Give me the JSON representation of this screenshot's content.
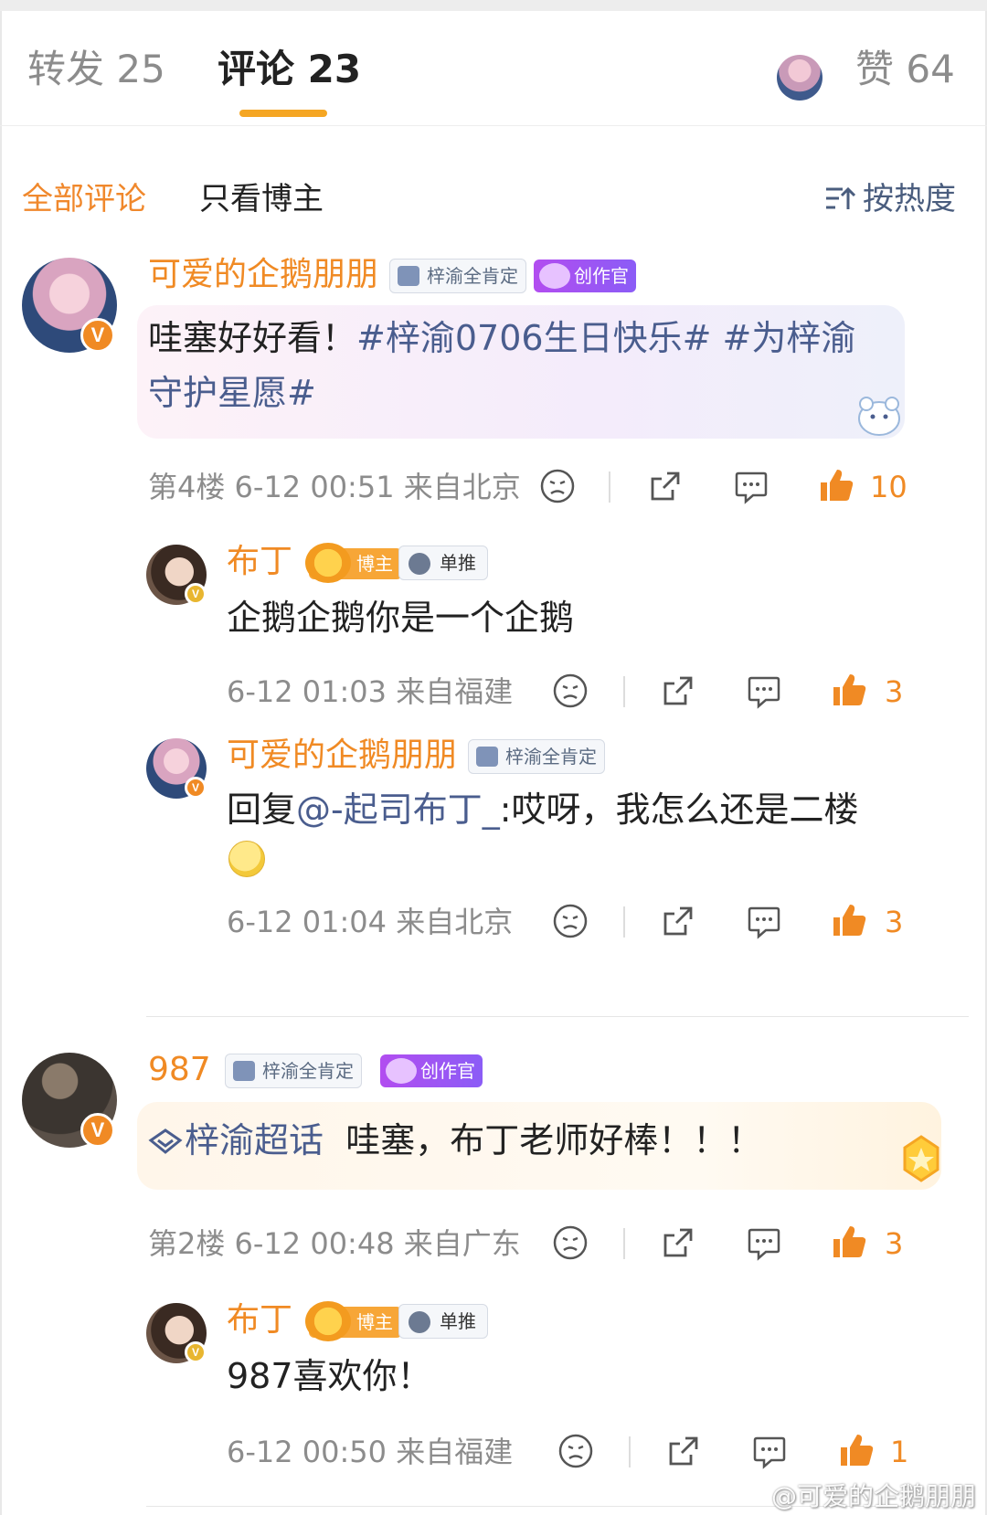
{
  "tabs": {
    "repost": "转发 25",
    "comments": "评论 23",
    "likes": "赞 64"
  },
  "filter": {
    "all": "全部评论",
    "blogger_only": "只看博主",
    "sort": "按热度"
  },
  "colors": {
    "accent": "#f08a24",
    "tab_indicator": "#f5a623",
    "link": "#4a5d8e"
  },
  "comments": [
    {
      "user": "可爱的企鹅朋朋",
      "tag": "梓渝全肯定",
      "creator_tag": "创作官",
      "text_plain": "哇塞好好看！",
      "text_link": "#梓渝0706生日快乐# #为梓渝守护星愿#",
      "meta": "第4楼 6-12 00:51 来自北京",
      "likes": "10",
      "replies": [
        {
          "user": "布丁",
          "boss_tag": "博主",
          "solo_tag": "单推",
          "text": "企鹅企鹅你是一个企鹅",
          "meta": "6-12 01:03 来自福建",
          "likes": "3"
        },
        {
          "user": "可爱的企鹅朋朋",
          "tag": "梓渝全肯定",
          "text_prefix": "回复",
          "text_mention": "@-起司布丁_",
          "text_body": ":哎呀，我怎么还是二楼",
          "emoji": "smiling-face-emoji",
          "meta": "6-12 01:04 来自北京",
          "likes": "3"
        }
      ]
    },
    {
      "user": "987",
      "tag": "梓渝全肯定",
      "creator_tag": "创作官",
      "text_link": "梓渝超话",
      "text_plain": "哇塞，布丁老师好棒！！！",
      "meta": "第2楼 6-12 00:48 来自广东",
      "likes": "3",
      "replies": [
        {
          "user": "布丁",
          "boss_tag": "博主",
          "solo_tag": "单推",
          "text": "987喜欢你！",
          "meta": "6-12 00:50 来自福建",
          "likes": "1"
        }
      ]
    }
  ],
  "watermark": "@可爱的企鹅朋朋"
}
